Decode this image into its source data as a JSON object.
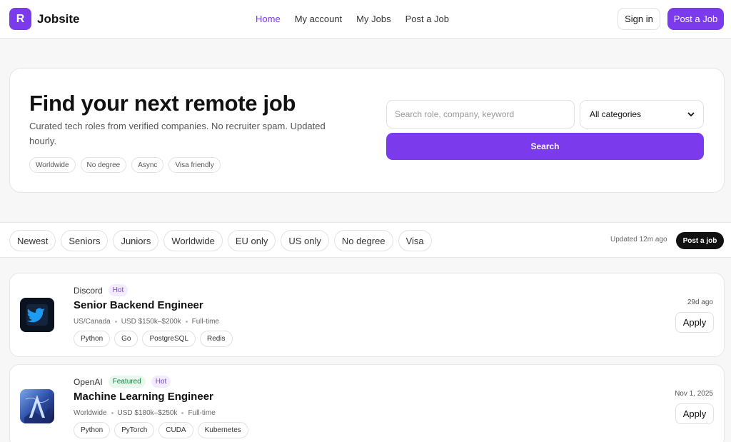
{
  "brand": {
    "logo_letter": "R",
    "name": "Jobsite",
    "accent_color": "#7c3aed"
  },
  "nav": {
    "links": [
      {
        "label": "Home",
        "active": true
      },
      {
        "label": "My account",
        "active": false
      },
      {
        "label": "My Jobs",
        "active": false
      },
      {
        "label": "Post a Job",
        "active": false
      }
    ],
    "sign_in_label": "Sign in",
    "post_job_label": "Post a Job"
  },
  "hero": {
    "title": "Find your next remote job",
    "subtitle": "Curated tech roles from verified companies. No recruiter spam. Updated hourly.",
    "chips": [
      "Worldwide",
      "No degree",
      "Async",
      "Visa friendly"
    ],
    "search_placeholder": "Search role, company, keyword",
    "category_selected": "All categories",
    "search_button": "Search"
  },
  "filters": {
    "chips": [
      "Newest",
      "Seniors",
      "Juniors",
      "Worldwide",
      "EU only",
      "US only",
      "No degree",
      "Visa"
    ],
    "updated_text": "Updated 12m ago",
    "post_job_label": "Post a job"
  },
  "jobs": [
    {
      "company": "Discord",
      "badges": [
        {
          "label": "Hot",
          "kind": "hot"
        }
      ],
      "title": "Senior Backend Engineer",
      "location": "US/Canada",
      "salary": "USD $150k–$200k",
      "type": "Full-time",
      "tags": [
        "Python",
        "Go",
        "PostgreSQL",
        "Redis"
      ],
      "posted": "29d ago",
      "apply_label": "Apply",
      "logo_icon": "bird-icon"
    },
    {
      "company": "OpenAI",
      "badges": [
        {
          "label": "Featured",
          "kind": "featured"
        },
        {
          "label": "Hot",
          "kind": "hot"
        }
      ],
      "title": "Machine Learning Engineer",
      "location": "Worldwide",
      "salary": "USD $180k–$250k",
      "type": "Full-time",
      "tags": [
        "Python",
        "PyTorch",
        "CUDA",
        "Kubernetes"
      ],
      "posted": "Nov 1, 2025",
      "apply_label": "Apply",
      "logo_icon": "abstract-a-icon"
    }
  ]
}
